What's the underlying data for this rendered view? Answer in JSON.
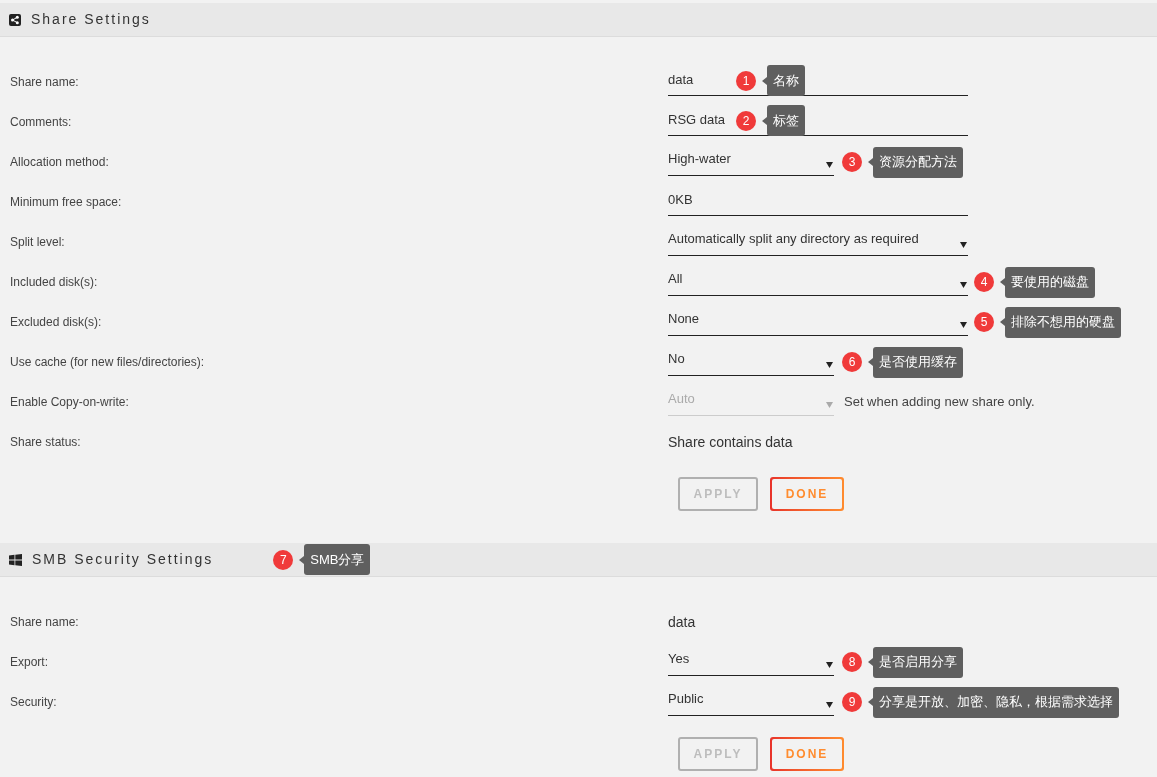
{
  "sections": [
    {
      "title": "Share Settings",
      "kind": "share",
      "rows": [
        {
          "label": "Share name:",
          "kind": "input",
          "value": "data",
          "note": {
            "number": "1",
            "text": "名称"
          }
        },
        {
          "label": "Comments:",
          "kind": "input",
          "value": "RSG data",
          "note": {
            "number": "2",
            "text": "标签"
          }
        },
        {
          "label": "Allocation method:",
          "kind": "select",
          "value": "High-water",
          "note": {
            "number": "3",
            "text": "资源分配方法"
          }
        },
        {
          "label": "Minimum free space:",
          "kind": "input",
          "value": "0KB"
        },
        {
          "label": "Split level:",
          "kind": "select-long",
          "value": "Automatically split any directory as required"
        },
        {
          "label": "Included disk(s):",
          "kind": "select-long",
          "value": "All",
          "note": {
            "number": "4",
            "text": "要使用的磁盘"
          }
        },
        {
          "label": "Excluded disk(s):",
          "kind": "select-long",
          "value": "None",
          "note": {
            "number": "5",
            "text": "排除不想用的硬盘"
          }
        },
        {
          "label": "Use cache (for new files/directories):",
          "kind": "select",
          "value": "No",
          "note": {
            "number": "6",
            "text": "是否使用缓存"
          }
        },
        {
          "label": "Enable Copy-on-write:",
          "kind": "select",
          "value": "Auto",
          "disabled": true,
          "hint": "Set when adding new share only."
        },
        {
          "label": "Share status:",
          "kind": "static",
          "value": "Share contains data"
        }
      ],
      "buttons": [
        {
          "label": "APPLY",
          "disabled": true
        },
        {
          "label": "DONE",
          "disabled": false
        }
      ]
    },
    {
      "title": "SMB Security Settings",
      "kind": "windows",
      "note": {
        "number": "7",
        "text": "SMB分享"
      },
      "rows": [
        {
          "label": "Share name:",
          "kind": "static",
          "value": "data"
        },
        {
          "label": "Export:",
          "kind": "select",
          "value": "Yes",
          "note": {
            "number": "8",
            "text": "是否启用分享"
          }
        },
        {
          "label": "Security:",
          "kind": "select",
          "value": "Public",
          "note": {
            "number": "9",
            "text": "分享是开放、加密、隐私，根据需求选择"
          }
        }
      ],
      "buttons": [
        {
          "label": "APPLY",
          "disabled": true
        },
        {
          "label": "DONE",
          "disabled": false
        }
      ]
    }
  ]
}
